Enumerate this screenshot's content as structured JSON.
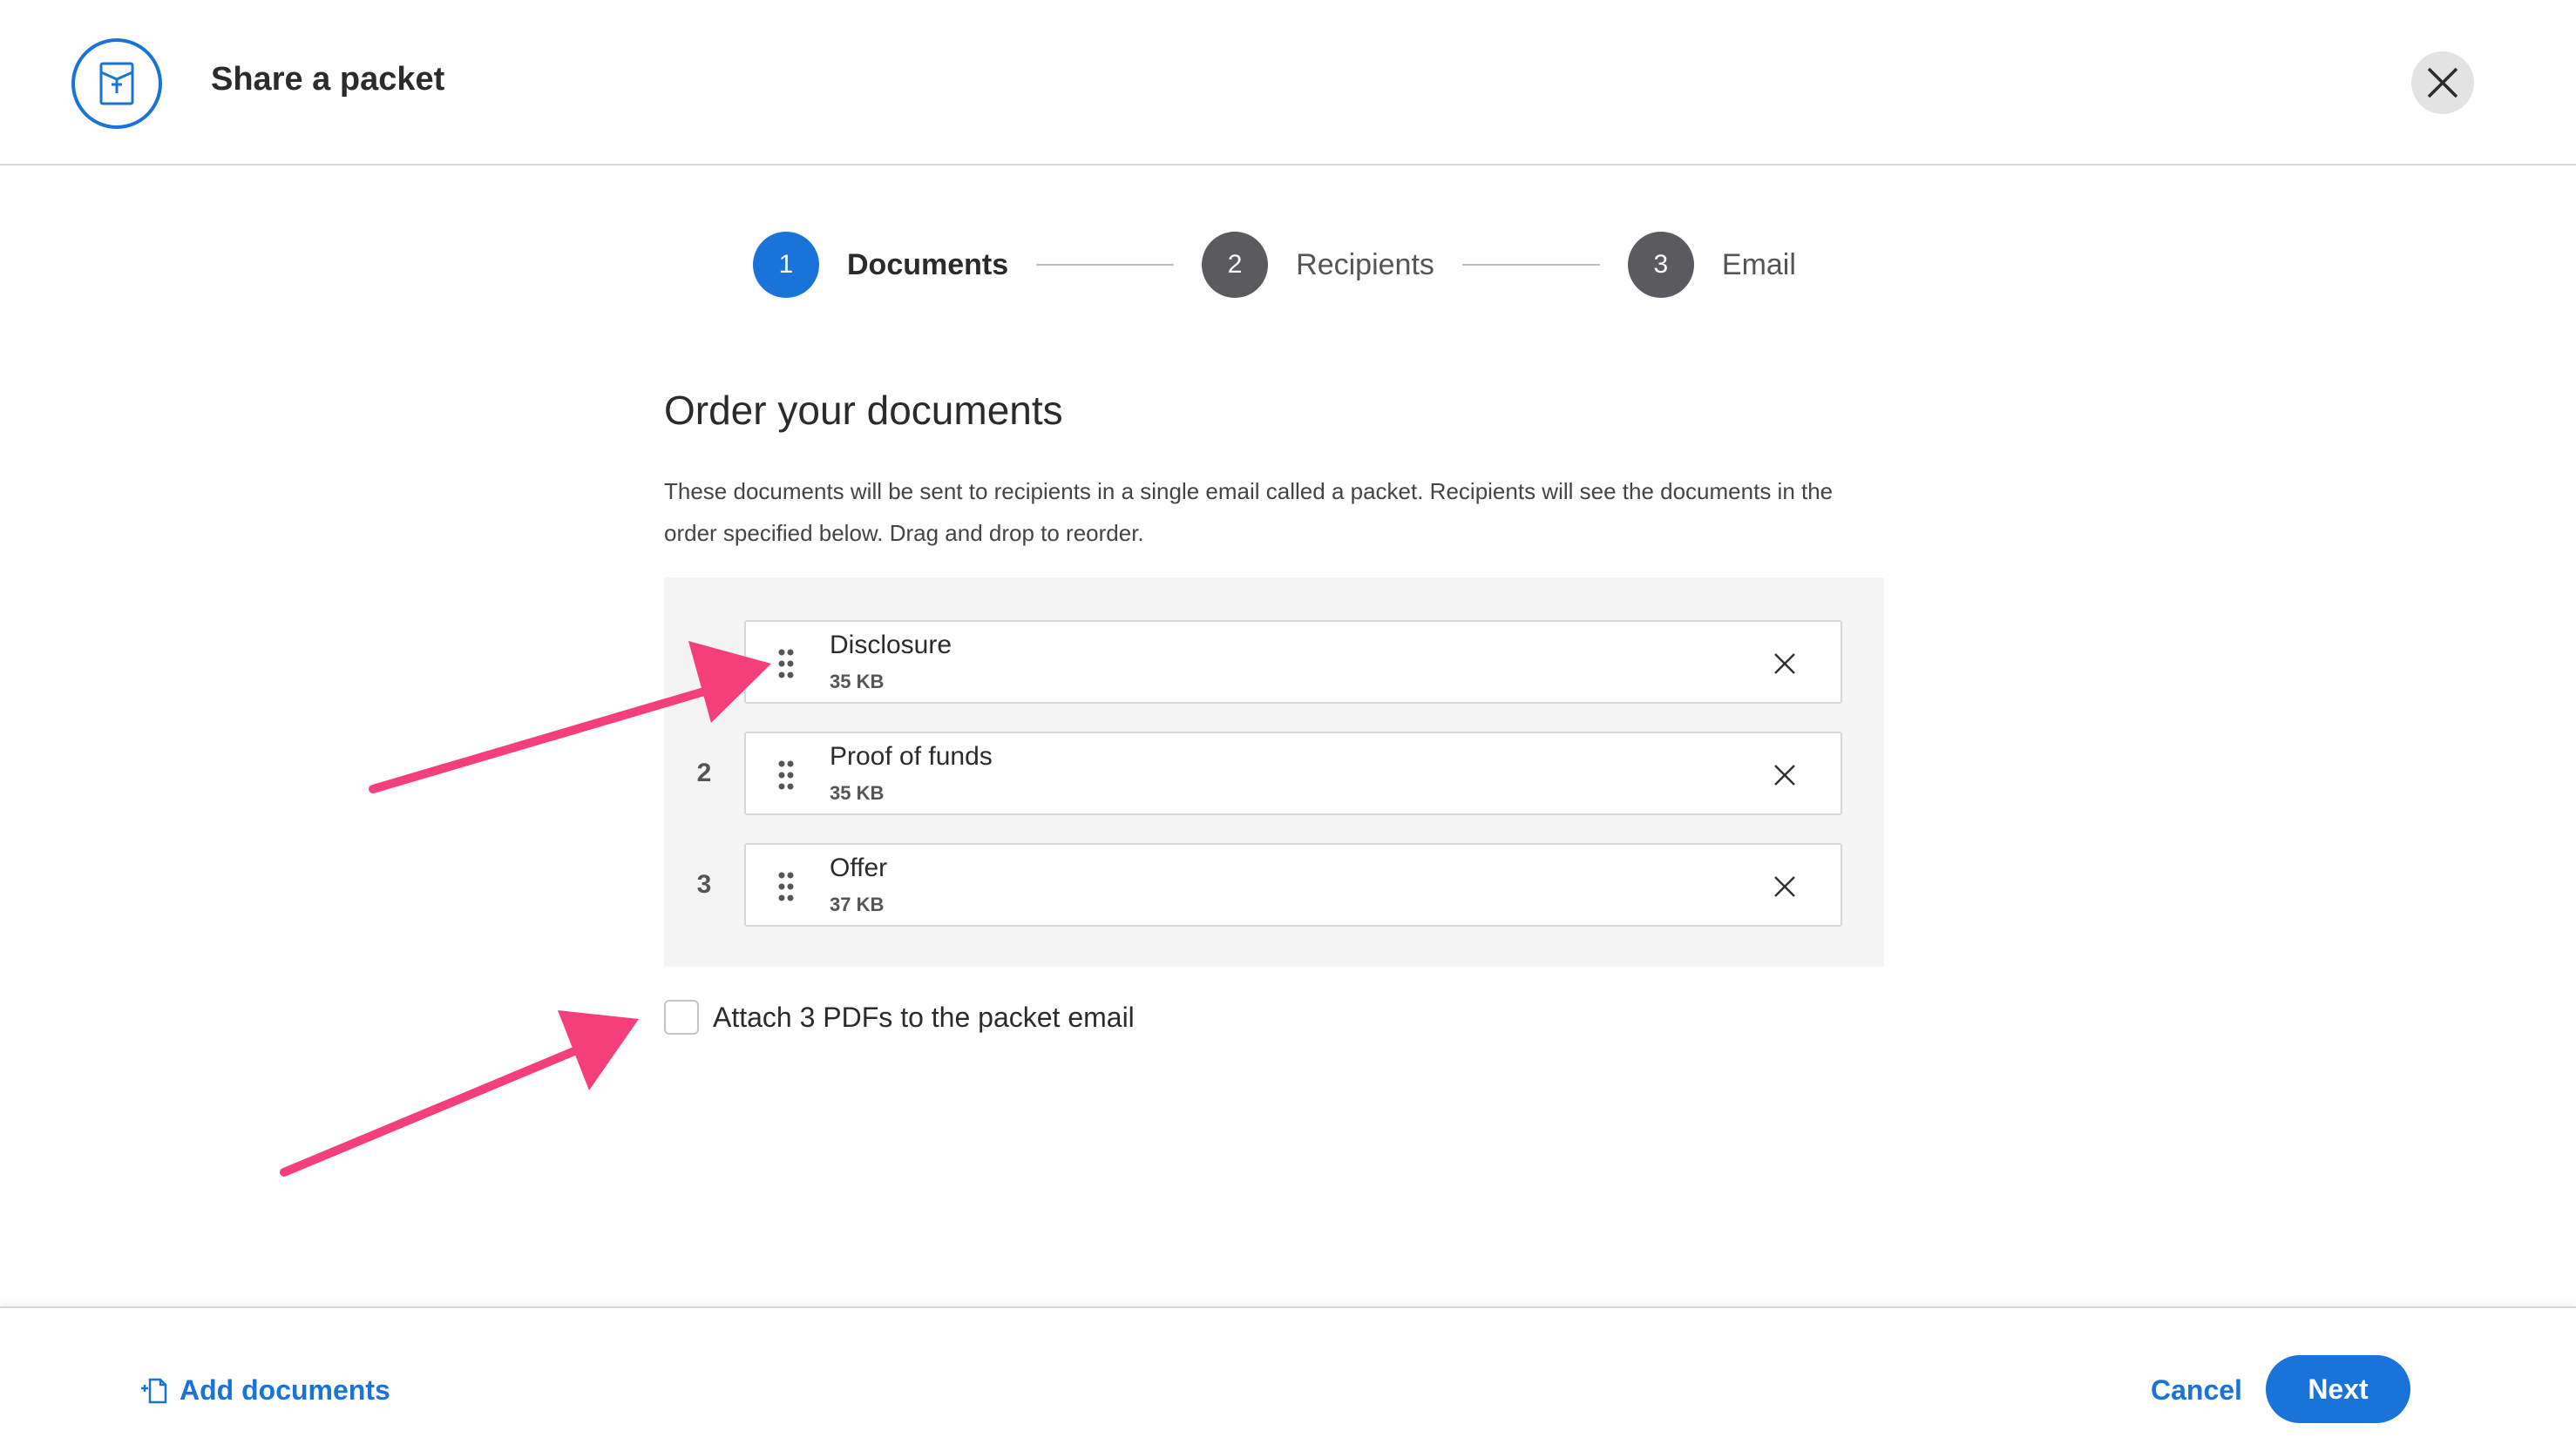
{
  "header": {
    "title": "Share a packet",
    "logo_icon": "packet-icon",
    "close_icon": "close-icon"
  },
  "stepper": {
    "steps": [
      {
        "number": "1",
        "label": "Documents",
        "state": "active"
      },
      {
        "number": "2",
        "label": "Recipients",
        "state": "inactive"
      },
      {
        "number": "3",
        "label": "Email",
        "state": "inactive"
      }
    ]
  },
  "main": {
    "title": "Order your documents",
    "description": "These documents will be sent to recipients in a single email called a packet. Recipients will see the documents in the order specified below. Drag and drop to reorder.",
    "documents": [
      {
        "index": "1",
        "name": "Disclosure",
        "size": "35 KB"
      },
      {
        "index": "2",
        "name": "Proof of funds",
        "size": "35 KB"
      },
      {
        "index": "3",
        "name": "Offer",
        "size": "37 KB"
      }
    ],
    "attach_label": "Attach 3 PDFs to the packet email",
    "attach_checked": false
  },
  "footer": {
    "add_documents_label": "Add documents",
    "cancel_label": "Cancel",
    "next_label": "Next"
  },
  "colors": {
    "accent": "#1a73d9",
    "step_inactive": "#5a5a5f",
    "annotation_arrow": "#f43f7a"
  }
}
